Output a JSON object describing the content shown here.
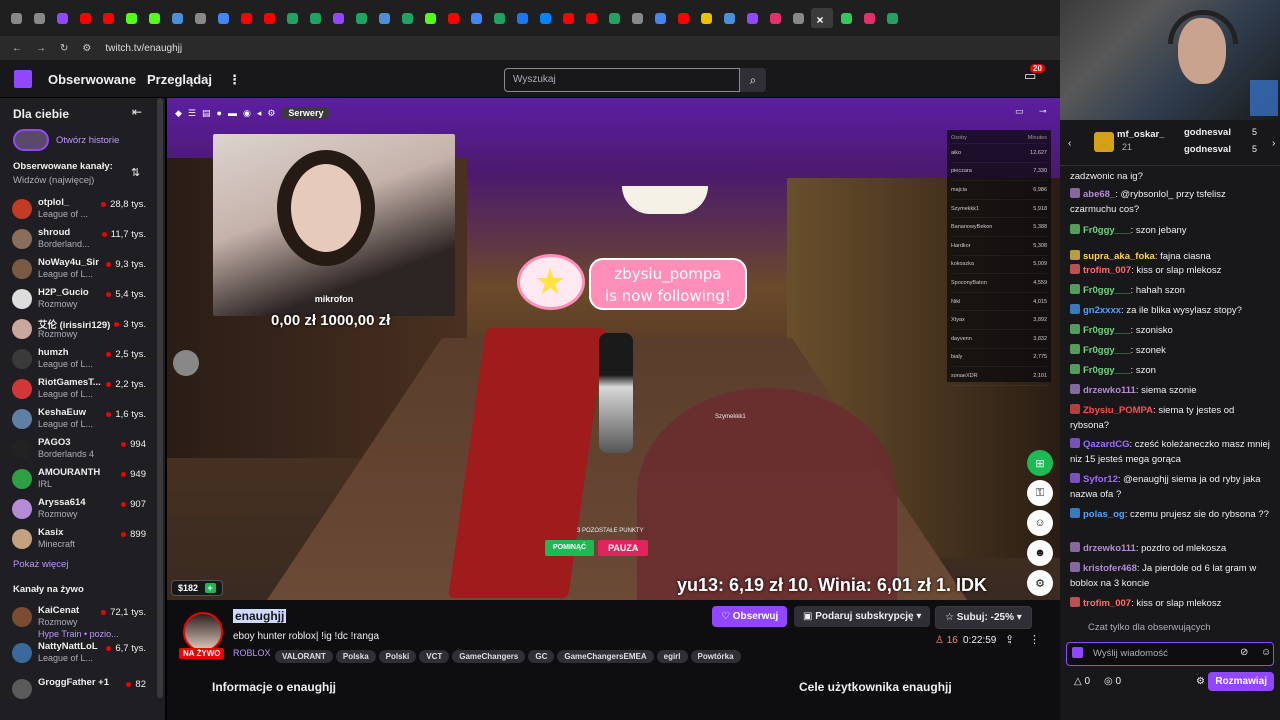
{
  "browser": {
    "url": "twitch.tv/enaughjj",
    "tab_icons": [
      "chevron-down-icon",
      "rss-icon",
      "twitch-icon",
      "youtube-icon",
      "youtube-icon",
      "kick-icon",
      "kick-icon",
      "app-icon",
      "x-icon",
      "google-icon",
      "youtube-icon",
      "youtube-icon",
      "sheets-icon",
      "sheets-icon",
      "twitch-icon",
      "sheets-icon",
      "app-icon",
      "sheets-icon",
      "kick-icon",
      "youtube-icon",
      "google-icon",
      "sheets-icon",
      "facebook-icon",
      "messenger-icon",
      "youtube-icon",
      "youtube-icon",
      "app-icon",
      "gear-icon",
      "google-icon",
      "youtube-icon",
      "v-icon",
      "app-icon",
      "twitch-icon",
      "instagram-icon",
      "app-icon",
      "close-icon",
      "app-icon",
      "instagram-icon",
      "sheets-icon"
    ],
    "tab_colors": [
      "#888",
      "#888",
      "#9147ff",
      "#ff0000",
      "#ff0000",
      "#53fc18",
      "#53fc18",
      "#4a90d9",
      "#888",
      "#4285f4",
      "#ff0000",
      "#ff0000",
      "#1ea362",
      "#1ea362",
      "#9147ff",
      "#1ea362",
      "#4a90d9",
      "#1ea362",
      "#53fc18",
      "#ff0000",
      "#4285f4",
      "#1ea362",
      "#1877f2",
      "#0084ff",
      "#ff0000",
      "#ff0000",
      "#1ea362",
      "#888",
      "#4285f4",
      "#ff0000",
      "#e8c100",
      "#4a90d9",
      "#9147ff",
      "#e1306c",
      "#888",
      "#888",
      "#34c759",
      "#e1306c",
      "#1ea362"
    ]
  },
  "topnav": {
    "following": "Obserwowane",
    "browse": "Przeglądaj",
    "more": "⋮",
    "search_placeholder": "Wyszukaj",
    "notif_count": "20"
  },
  "sidebar": {
    "title": "Dla ciebie",
    "collapse": "⇤",
    "story": "Otwórz historie",
    "followed_header": "Obserwowane kanały:",
    "followed_sub": "Widzów (najwięcej)",
    "followed": [
      {
        "name": "otplol_",
        "game": "League of ...",
        "viewers": "28,8 tys.",
        "color": "#c23b22"
      },
      {
        "name": "shroud",
        "game": "Borderland...",
        "viewers": "11,7 tys.",
        "color": "#8a6d5b"
      },
      {
        "name": "NoWay4u_Sir",
        "game": "League of L...",
        "viewers": "9,3 tys.",
        "color": "#7b5a43"
      },
      {
        "name": "H2P_Gucio",
        "game": "Rozmowy",
        "viewers": "5,4 tys.",
        "color": "#ddd"
      },
      {
        "name": "艾伦 (irissiri129)",
        "game": "Rozmowy",
        "viewers": "3 tys.",
        "color": "#c9a79a"
      },
      {
        "name": "humzh",
        "game": "League of L...",
        "viewers": "2,5 tys.",
        "color": "#3a3a3a"
      },
      {
        "name": "RiotGamesT...",
        "game": "League of L...",
        "viewers": "2,2 tys.",
        "color": "#d13639"
      },
      {
        "name": "KeshaEuw",
        "game": "League of L...",
        "viewers": "1,6 tys.",
        "color": "#5f7fa5"
      },
      {
        "name": "PAGO3",
        "game": "Borderlands 4",
        "viewers": "994",
        "color": "#222"
      },
      {
        "name": "AMOURANTH",
        "game": "IRL",
        "viewers": "949",
        "color": "#2ea043"
      },
      {
        "name": "Aryssa614",
        "game": "Rozmowy",
        "viewers": "907",
        "color": "#b58ad6"
      },
      {
        "name": "Kasix",
        "game": "Minecraft",
        "viewers": "899",
        "color": "#c5a27f"
      }
    ],
    "show_more": "Pokaż więcej",
    "live_header": "Kanały na żywo",
    "live": [
      {
        "name": "KaiCenat",
        "game": "Rozmowy",
        "extra": "Hype Train • pozio...",
        "viewers": "72,1 tys.",
        "color": "#7b4b32"
      },
      {
        "name": "NattyNattLoL",
        "game": "League of L...",
        "viewers": "6,7 tys.",
        "color": "#3b6a9a"
      },
      {
        "name": "GroggFather +1",
        "game": "",
        "viewers": "82",
        "color": "#5a5a5a"
      }
    ]
  },
  "player": {
    "toolbar_servers": "Serwery",
    "cam_name": "mikrofon",
    "money": "0,00 zł   1000,00 zł",
    "follow_user": "zbysiu_pompa",
    "follow_text": "is now following!",
    "leaderboard_header": [
      "Osoby",
      "Minutes"
    ],
    "leaderboard": [
      [
        "aiko",
        "12,627"
      ],
      [
        "pieczara",
        "7,330"
      ],
      [
        "majcia",
        "6,986"
      ],
      [
        "Szymekkk1",
        "5,918"
      ],
      [
        "BananowyBekon",
        "5,388"
      ],
      [
        "Hardkor",
        "5,308"
      ],
      [
        "kokoszka",
        "5,009"
      ],
      [
        "SpoconyBaton",
        "4,559"
      ],
      [
        "Nikl",
        "4,015"
      ],
      [
        "Xtyax",
        "3,892"
      ],
      [
        "dayvenn",
        "3,832"
      ],
      [
        "bialy",
        "2,775"
      ],
      [
        "sonaeXDR",
        "2,101"
      ]
    ],
    "ticker": "yu13: 6,19 zł    10. Winia: 6,01 zł    1. IDK",
    "points_label": "3 POZOSTAŁE PUNKTY",
    "skip": "POMINĄĆ",
    "pause": "PAUZA",
    "player_tag": "Szymekkk1",
    "coins": "$182"
  },
  "info": {
    "channel": "enaughjj",
    "live": "NA ŻYWO",
    "title": "eboy hunter roblox| !ig !dc !ranga",
    "game": "ROBLOX",
    "tags": [
      "VALORANT",
      "Polska",
      "Polski",
      "VCT",
      "GameChangers",
      "GC",
      "GameChangersEMEA",
      "egirl",
      "Powtórka"
    ],
    "follow_btn": "Obserwuj",
    "gift_btn": "Podaruj subskrypcję",
    "sub_btn": "Subuj: -25%",
    "viewers": "16",
    "uptime": "0:22:59",
    "about": "Informacje o enaughjj",
    "goals": "Cele użytkownika enaughjj"
  },
  "chat": {
    "gifters": [
      {
        "name": "mf_oskar_",
        "count": "21"
      },
      {
        "name": "godnesval",
        "count": "5"
      },
      {
        "name": "godnesval",
        "count": "5"
      }
    ],
    "messages": [
      {
        "user": "",
        "text": "zadzwonic na ig?",
        "color": "#efeff1"
      },
      {
        "user": "abe68_",
        "text": "@rybsonlol_ przy tsfelisz czarmuchu cos?",
        "color": "#b58ad6"
      },
      {
        "user": "Fr0ggy___",
        "text": "szon jebany",
        "color": "#6fd47a"
      },
      {
        "user": "supra_aka_foka",
        "text": "fajna ciasna",
        "color": "#ffd447"
      },
      {
        "user": "trofim_007",
        "text": "kiss or slap mlekosz",
        "color": "#ff6b6b"
      },
      {
        "user": "Fr0ggy___",
        "text": "hahah szon",
        "color": "#6fd47a"
      },
      {
        "user": "gn2xxxx",
        "text": "za ile blika wysylasz stopy?",
        "color": "#4aa3ff"
      },
      {
        "user": "Fr0ggy___",
        "text": "szonisko",
        "color": "#6fd47a"
      },
      {
        "user": "Fr0ggy___",
        "text": "szonek",
        "color": "#6fd47a"
      },
      {
        "user": "Fr0ggy___",
        "text": "szon",
        "color": "#6fd47a"
      },
      {
        "user": "drzewko111",
        "text": "siema szonie",
        "color": "#b58ad6"
      },
      {
        "user": "Zbysiu_POMPA",
        "text": "siema ty jestes od rybsona?",
        "color": "#ff4d4d"
      },
      {
        "user": "QazardCG",
        "text": "cześć koleżaneczko masz mniej niz 15 jesteś mega gorąca",
        "color": "#9f6bff"
      },
      {
        "user": "Syfor12",
        "text": "@enaughjj siema ja od ryby jaka nazwa ofa ?",
        "color": "#9f6bff"
      },
      {
        "user": "polas_og",
        "text": "czemu prujesz sie do rybsona ??",
        "color": "#4aa3ff"
      },
      {
        "user": "drzewko111",
        "text": "pozdro od mlekosza",
        "color": "#b58ad6"
      },
      {
        "user": "kristofer468",
        "text": "Ja pierdole od 6 lat gram w boblox na 3 koncie",
        "color": "#b58ad6"
      },
      {
        "user": "trofim_007",
        "text": "kiss or slap mlekosz",
        "color": "#ff6b6b"
      }
    ],
    "followers_only": "Czat tylko dla obserwujących",
    "input_placeholder": "Wyślij wiadomość",
    "points_a": "0",
    "points_b": "0",
    "send": "Rozmawiaj"
  }
}
